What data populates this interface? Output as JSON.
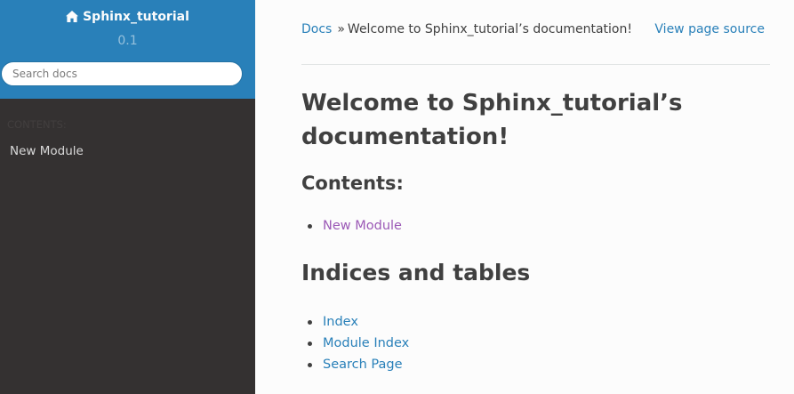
{
  "sidebar": {
    "project_name": "Sphinx_tutorial",
    "version": "0.1",
    "search_placeholder": "Search docs",
    "caption": "CONTENTS:",
    "nav_items": [
      {
        "label": "New Module"
      }
    ],
    "colors": {
      "top": "#2980b9",
      "background": "#343131"
    }
  },
  "breadcrumbs": {
    "root": "Docs",
    "separator": "»",
    "current": "Welcome to Sphinx_tutorial’s documentation!",
    "view_source": "View page source"
  },
  "content": {
    "title": "Welcome to Sphinx_tutorial’s documentation!",
    "contents_heading": "Contents:",
    "contents_items": [
      "New Module"
    ],
    "indices_heading": "Indices and tables",
    "indices_items": [
      "Index",
      "Module Index",
      "Search Page"
    ]
  },
  "colors": {
    "link": "#2980b9",
    "visited_link": "#9b59b6",
    "text": "#404040"
  }
}
